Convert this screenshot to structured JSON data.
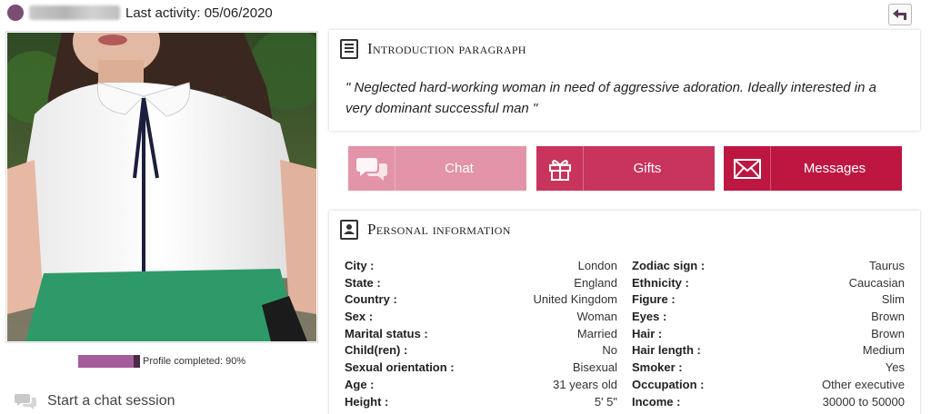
{
  "header": {
    "last_activity": "Last activity: 05/06/2020",
    "status_color": "#7a4e73"
  },
  "profile": {
    "progress_percent": 90,
    "progress_label": "Profile completed: 90%",
    "start_chat_label": "Start a chat session"
  },
  "intro": {
    "title": "Introduction paragraph",
    "text": "\" Neglected hard-working woman in need of aggressive adoration. Ideally interested in a very dominant successful man \""
  },
  "actions": {
    "chat_label": "Chat",
    "gifts_label": "Gifts",
    "messages_label": "Messages"
  },
  "personal": {
    "title": "Personal information",
    "left": [
      {
        "key": "City :",
        "value": "London"
      },
      {
        "key": "State :",
        "value": "England"
      },
      {
        "key": "Country :",
        "value": "United Kingdom"
      },
      {
        "key": "Sex :",
        "value": "Woman"
      },
      {
        "key": "Marital status :",
        "value": "Married"
      },
      {
        "key": "Child(ren) :",
        "value": "No"
      },
      {
        "key": "Sexual orientation :",
        "value": "Bisexual"
      },
      {
        "key": "Age :",
        "value": "31 years old"
      },
      {
        "key": "Height :",
        "value": "5' 5\""
      }
    ],
    "right": [
      {
        "key": "Zodiac sign :",
        "value": "Taurus"
      },
      {
        "key": "Ethnicity :",
        "value": "Caucasian"
      },
      {
        "key": "Figure :",
        "value": "Slim"
      },
      {
        "key": "Eyes :",
        "value": "Brown"
      },
      {
        "key": "Hair :",
        "value": "Brown"
      },
      {
        "key": "Hair length :",
        "value": "Medium"
      },
      {
        "key": "Smoker :",
        "value": "Yes"
      },
      {
        "key": "Occupation :",
        "value": "Other executive"
      },
      {
        "key": "Income :",
        "value": "30000 to 50000"
      }
    ]
  },
  "colors": {
    "accent_purple": "#a45c9a",
    "chat_button": "#e394a8",
    "gifts_button": "#c8345c",
    "messages_button": "#bd1741"
  }
}
